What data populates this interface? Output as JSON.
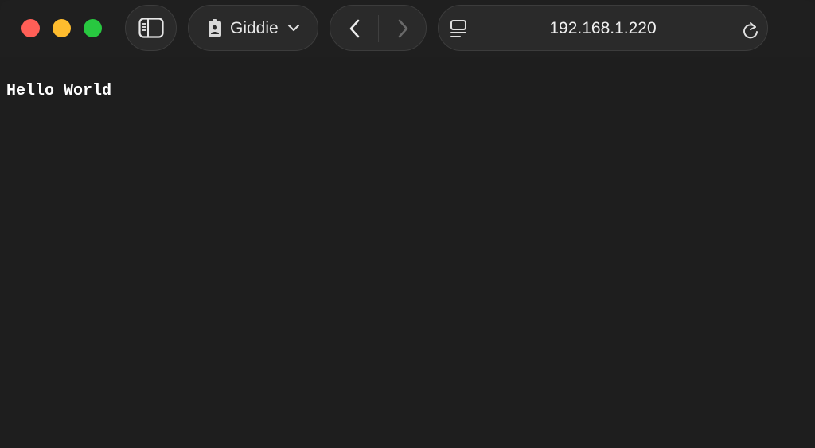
{
  "window": {
    "traffic_lights": {
      "close": "#ff5f57",
      "minimize": "#febc2e",
      "zoom": "#28c840"
    }
  },
  "toolbar": {
    "sidebar_icon": "sidebar-icon",
    "profile": {
      "icon": "id-badge-icon",
      "label": "Giddie"
    },
    "nav": {
      "back_icon": "chevron-left-icon",
      "forward_icon": "chevron-right-icon"
    },
    "address": {
      "page_icon": "page-menu-icon",
      "url": "192.168.1.220",
      "reload_icon": "reload-icon"
    }
  },
  "page": {
    "body_text": "Hello World"
  }
}
